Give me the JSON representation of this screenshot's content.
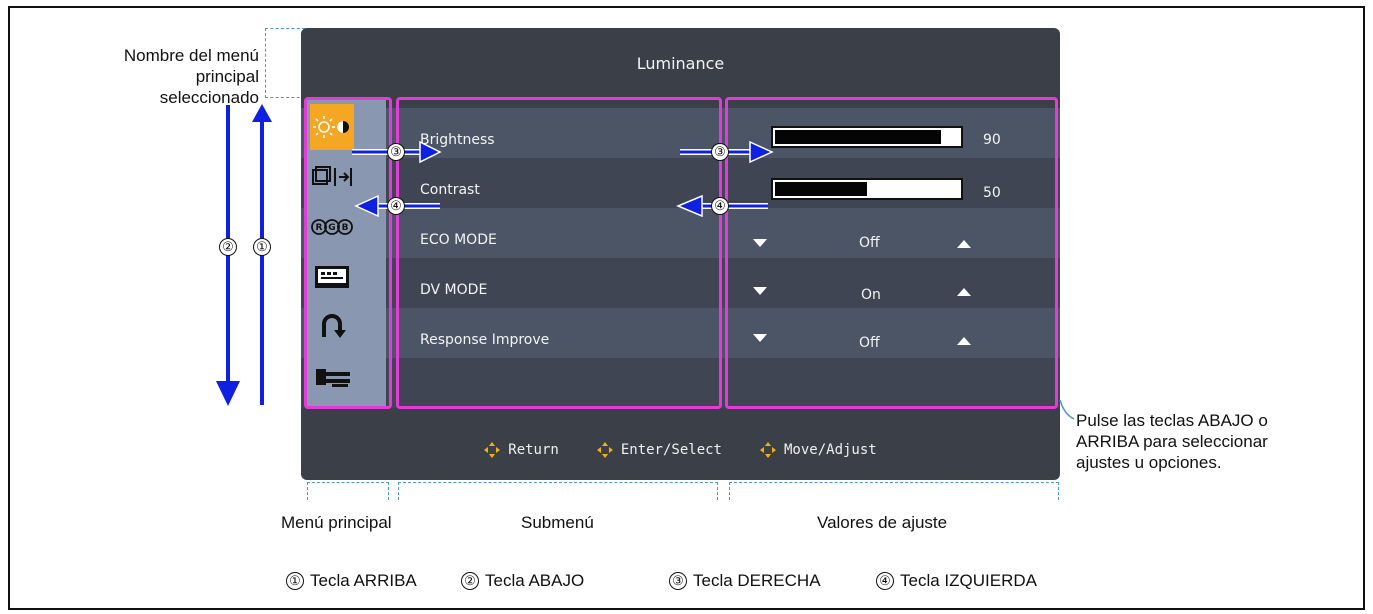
{
  "annotations": {
    "main_menu_name_line1": "Nombre del menú",
    "main_menu_name_line2": "principal seleccionado",
    "press_keys_line1": "Pulse las teclas ABAJO o",
    "press_keys_line2": "ARRIBA para seleccionar",
    "press_keys_line3": "ajustes u opciones.",
    "main_menu": "Menú principal",
    "submenu": "Submenú",
    "values": "Valores de ajuste"
  },
  "osd": {
    "title": "Luminance",
    "main_menu_icons": [
      "brightness-contrast-icon",
      "picture-size-icon",
      "rgb-icon",
      "osd-setup-icon",
      "return-icon",
      "tools-icon"
    ],
    "selected_main_index": 0,
    "submenu": [
      {
        "label": "Brightness",
        "type": "bar",
        "value": 90,
        "display": "90"
      },
      {
        "label": "Contrast",
        "type": "bar",
        "value": 50,
        "display": "50"
      },
      {
        "label": "ECO MODE",
        "type": "select",
        "display": "Off"
      },
      {
        "label": "DV MODE",
        "type": "select",
        "display": "On"
      },
      {
        "label": "Response Improve",
        "type": "select",
        "display": "Off"
      }
    ],
    "footer": [
      {
        "icon": "dpad-icon",
        "label": "Return"
      },
      {
        "icon": "dpad-icon",
        "label": "Enter/Select"
      },
      {
        "icon": "dpad-icon",
        "label": "Move/Adjust"
      }
    ]
  },
  "keys": {
    "up_mark": "①",
    "down_mark": "②",
    "right_mark": "③",
    "left_mark": "④",
    "up": "Tecla ARRIBA",
    "down": "Tecla ABAJO",
    "right": "Tecla DERECHA",
    "left": "Tecla IZQUIERDA"
  },
  "colors": {
    "osd_bg": "#3b3f48",
    "highlight": "#e23bd8",
    "arrow": "#1020e0",
    "selected": "#f5a623"
  }
}
